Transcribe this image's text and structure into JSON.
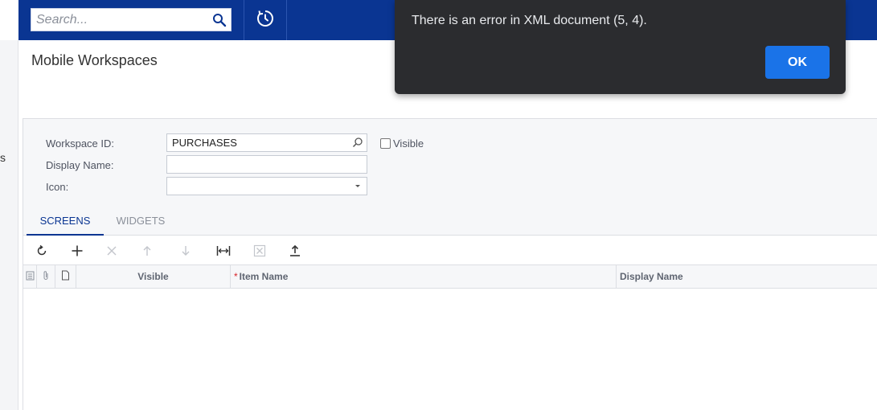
{
  "search": {
    "placeholder": "Search..."
  },
  "left_strip": {
    "fragment": "s"
  },
  "page": {
    "title": "Mobile Workspaces"
  },
  "form": {
    "workspace_id_label": "Workspace ID:",
    "workspace_id_value": "PURCHASES",
    "visible_label": "Visible",
    "visible_checked": false,
    "display_name_label": "Display Name:",
    "display_name_value": "",
    "icon_label": "Icon:",
    "icon_value": ""
  },
  "tabs": [
    {
      "label": "SCREENS",
      "active": true
    },
    {
      "label": "WIDGETS",
      "active": false
    }
  ],
  "toolbar": {
    "buttons": [
      "refresh-icon",
      "add-icon",
      "delete-icon",
      "move-up-icon",
      "move-down-icon",
      "fit-width-icon",
      "export-excel-icon",
      "upload-icon"
    ]
  },
  "grid": {
    "columns": {
      "visible": "Visible",
      "item_name": "Item Name",
      "item_name_required": "*",
      "display_name": "Display Name"
    },
    "rows": []
  },
  "dialog": {
    "message": "There is an error in XML document (5, 4).",
    "ok_label": "OK"
  },
  "colors": {
    "topbar": "#0a3592",
    "accent": "#0a3592",
    "dialog_bg": "#2b2c2f",
    "ok_button": "#1a73e8",
    "required": "#d8242a"
  }
}
